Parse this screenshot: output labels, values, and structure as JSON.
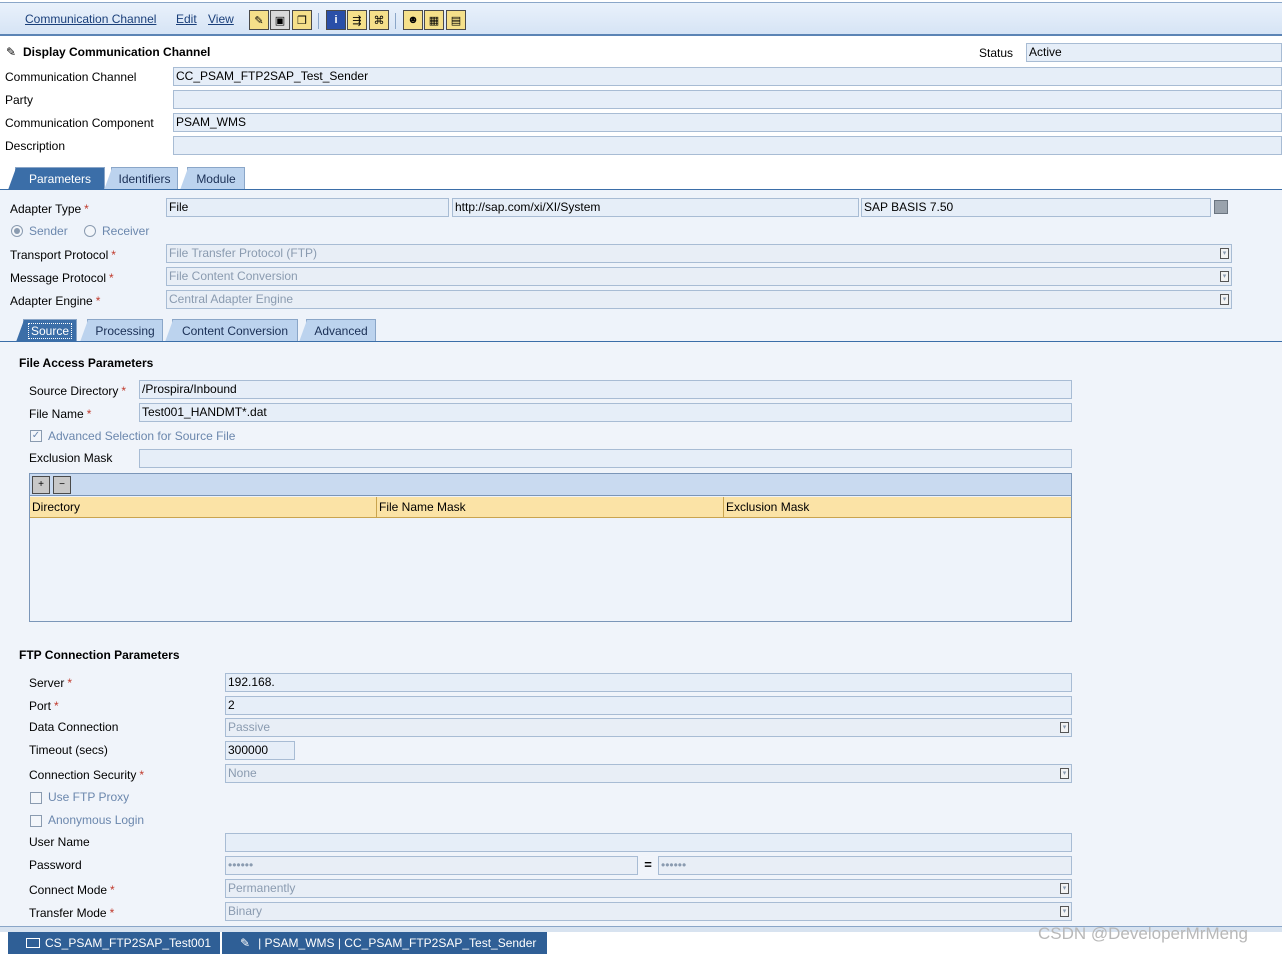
{
  "menu": {
    "items": [
      "Communication Channel",
      "Edit",
      "View"
    ]
  },
  "header": {
    "title": "Display Communication Channel",
    "status_label": "Status",
    "status_value": "Active",
    "channel_label": "Communication Channel",
    "channel_value": "CC_PSAM_FTP2SAP_Test_Sender",
    "party_label": "Party",
    "party_value": "",
    "component_label": "Communication Component",
    "component_value": "PSAM_WMS",
    "description_label": "Description",
    "description_value": ""
  },
  "main_tabs": [
    "Parameters",
    "Identifiers",
    "Module"
  ],
  "adapter": {
    "adapter_type_label": "Adapter Type",
    "adapter_type_value": "File",
    "namespace_value": "http://sap.com/xi/XI/System",
    "swcv_value": "SAP BASIS 7.50",
    "sender_label": "Sender",
    "receiver_label": "Receiver",
    "transport_label": "Transport Protocol",
    "transport_value": "File Transfer Protocol (FTP)",
    "message_label": "Message Protocol",
    "message_value": "File Content Conversion",
    "engine_label": "Adapter Engine",
    "engine_value": "Central Adapter Engine"
  },
  "sub_tabs": [
    "Source",
    "Processing",
    "Content Conversion",
    "Advanced"
  ],
  "file_access": {
    "title": "File Access Parameters",
    "source_dir_label": "Source Directory",
    "source_dir_value": "/Prospira/Inbound",
    "file_name_label": "File Name",
    "file_name_value": "Test001_HANDMT*.dat",
    "adv_selection_label": "Advanced Selection for Source File",
    "exclusion_label": "Exclusion Mask",
    "exclusion_value": "",
    "table_columns": [
      "Directory",
      "File Name Mask",
      "Exclusion Mask"
    ]
  },
  "ftp": {
    "title": "FTP Connection Parameters",
    "server_label": "Server",
    "server_value": "192.168.",
    "port_label": "Port",
    "port_value": "2",
    "data_conn_label": "Data Connection",
    "data_conn_value": "Passive",
    "timeout_label": "Timeout (secs)",
    "timeout_value": "300000",
    "security_label": "Connection Security",
    "security_value": "None",
    "proxy_label": "Use FTP Proxy",
    "anon_label": "Anonymous Login",
    "user_label": "User Name",
    "user_value": "",
    "password_label": "Password",
    "password_value": "••••••",
    "password_confirm_value": "••••••",
    "equals_sign": "=",
    "connect_mode_label": "Connect Mode",
    "connect_mode_value": "Permanently",
    "transfer_mode_label": "Transfer Mode",
    "transfer_mode_value": "Binary"
  },
  "footer": {
    "tab1": "CS_PSAM_FTP2SAP_Test001",
    "tab2": "| PSAM_WMS | CC_PSAM_FTP2SAP_Test_Sender",
    "watermark": "CSDN @DeveloperMrMeng"
  },
  "required_mark": "*"
}
